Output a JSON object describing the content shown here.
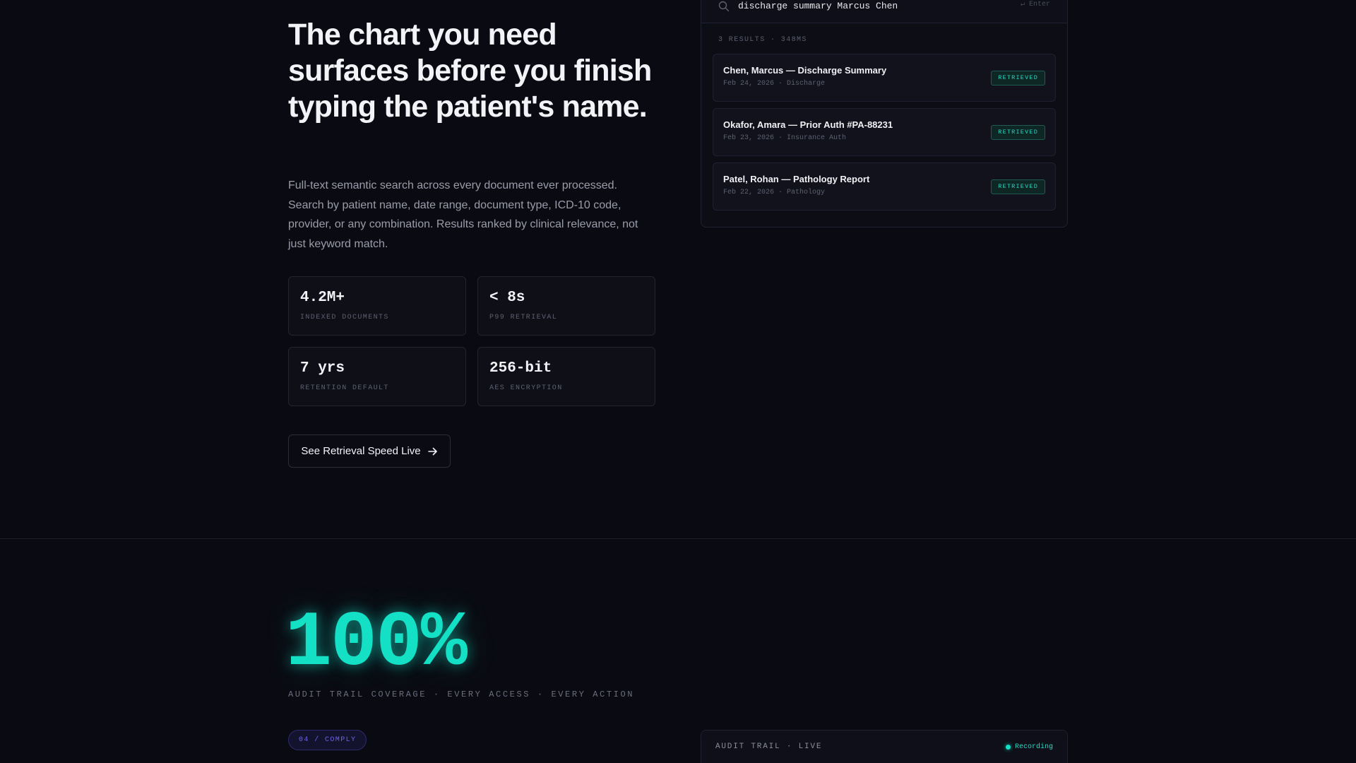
{
  "hero": {
    "title": "The chart you need surfaces before you finish typing the patient's name.",
    "description": "Full-text semantic search across every document ever processed. Search by patient name, date range, document type, ICD-10 code, provider, or any combination. Results ranked by clinical relevance, not just keyword match.",
    "stats": [
      {
        "value": "4.2M+",
        "label": "INDEXED DOCUMENTS"
      },
      {
        "value": "< 8s",
        "label": "P99 RETRIEVAL"
      },
      {
        "value": "7 yrs",
        "label": "RETENTION DEFAULT"
      },
      {
        "value": "256-bit",
        "label": "AES ENCRYPTION"
      }
    ],
    "cta_label": "See Retrieval Speed Live"
  },
  "search": {
    "query": "discharge summary Marcus Chen",
    "hint": "↵ Enter",
    "results_meta": "3 RESULTS · 348MS",
    "results": [
      {
        "title": "Chen, Marcus — Discharge Summary",
        "meta": "Feb 24, 2026 · Discharge",
        "badge": "RETRIEVED"
      },
      {
        "title": "Okafor, Amara — Prior Auth #PA-88231",
        "meta": "Feb 23, 2026 · Insurance Auth",
        "badge": "RETRIEVED"
      },
      {
        "title": "Patel, Rohan — Pathology Report",
        "meta": "Feb 22, 2026 · Pathology",
        "badge": "RETRIEVED"
      }
    ]
  },
  "audit": {
    "metric": "100%",
    "caption": "AUDIT TRAIL COVERAGE · EVERY ACCESS · EVERY ACTION",
    "pill": "04 / COMPLY",
    "panel_title": "AUDIT TRAIL · LIVE",
    "status": "Recording"
  },
  "colors": {
    "background": "#0a0b12",
    "accent_teal": "#14e0c6",
    "accent_violet": "#6e63e8"
  },
  "icons": {
    "search": "search-icon",
    "cta_arrow": "arrow-right-icon",
    "status": "recording-dot-icon"
  }
}
